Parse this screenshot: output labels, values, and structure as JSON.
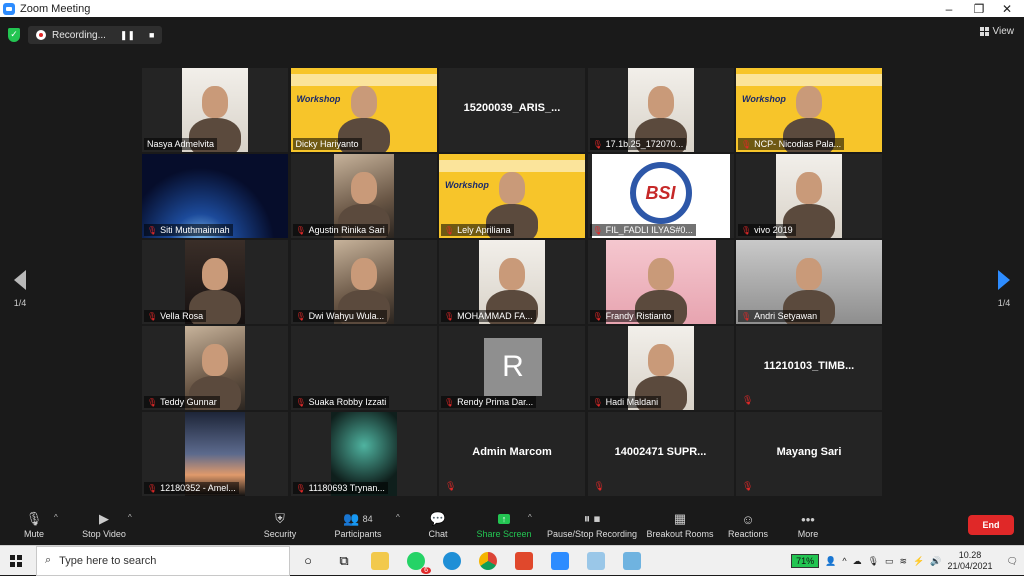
{
  "window": {
    "title": "Zoom Meeting",
    "minimize": "–",
    "maximize": "❐",
    "close": "✕"
  },
  "meeting": {
    "recording_label": "Recording...",
    "view_label": "View",
    "page_left": "1/4",
    "page_right": "1/4"
  },
  "participants": [
    {
      "name": "Nasya Admelvita",
      "muted": false,
      "type": "video",
      "scene": "light"
    },
    {
      "name": "Dicky Hariyanto",
      "muted": false,
      "type": "video",
      "scene": "poster",
      "active": true
    },
    {
      "name": "15200039_ARIS_...",
      "muted": false,
      "type": "noname"
    },
    {
      "name": "17.1b.25_172070...",
      "muted": true,
      "type": "video",
      "scene": "light"
    },
    {
      "name": "NCP- Nicodias Pala...",
      "muted": true,
      "type": "video",
      "scene": "poster"
    },
    {
      "name": "Siti Muthmainnah",
      "muted": true,
      "type": "video",
      "scene": "space"
    },
    {
      "name": "Agustin Rinika Sari",
      "muted": true,
      "type": "video",
      "scene": "room"
    },
    {
      "name": "Lely Apriliana",
      "muted": true,
      "type": "video",
      "scene": "poster"
    },
    {
      "name": "FIL_FADLI ILYAS#0...",
      "muted": true,
      "type": "video",
      "scene": "logo"
    },
    {
      "name": "vivo 2019",
      "muted": true,
      "type": "video",
      "scene": "light"
    },
    {
      "name": "Vella Rosa",
      "muted": true,
      "type": "video",
      "scene": "dark"
    },
    {
      "name": "Dwi Wahyu Wula...",
      "muted": true,
      "type": "video",
      "scene": "room"
    },
    {
      "name": "MOHAMMAD FA...",
      "muted": true,
      "type": "video",
      "scene": "light"
    },
    {
      "name": "Frandy Ristianto",
      "muted": true,
      "type": "video",
      "scene": "pink"
    },
    {
      "name": "Andri Setyawan",
      "muted": true,
      "type": "video",
      "scene": "grey"
    },
    {
      "name": "Teddy Gunnar",
      "muted": true,
      "type": "video",
      "scene": "room"
    },
    {
      "name": "Suaka Robby Izzati",
      "muted": true,
      "type": "blank"
    },
    {
      "name": "Rendy Prima Dar...",
      "muted": true,
      "type": "avatar",
      "initial": "R"
    },
    {
      "name": "Hadi Maldani",
      "muted": true,
      "type": "video",
      "scene": "light"
    },
    {
      "name": "11210103_TIMB...",
      "muted": true,
      "type": "noname"
    },
    {
      "name": "12180352 - Amel...",
      "muted": true,
      "type": "video",
      "scene": "sunset"
    },
    {
      "name": "11180693 Trynan...",
      "muted": true,
      "type": "video",
      "scene": "art"
    },
    {
      "name": "Admin Marcom",
      "muted": true,
      "type": "noname"
    },
    {
      "name": "14002471 SUPR...",
      "muted": true,
      "type": "noname"
    },
    {
      "name": "Mayang Sari",
      "muted": true,
      "type": "noname"
    }
  ],
  "poster_text": "Workshop",
  "logo_text": "BSI",
  "toolbar": {
    "mute": "Mute",
    "stop_video": "Stop Video",
    "security": "Security",
    "participants": "Participants",
    "participants_count": "84",
    "chat": "Chat",
    "share_screen": "Share Screen",
    "pause_stop_recording": "Pause/Stop Recording",
    "breakout_rooms": "Breakout Rooms",
    "reactions": "Reactions",
    "more": "More",
    "end": "End"
  },
  "taskbar": {
    "search_placeholder": "Type here to search",
    "battery": "71%",
    "time": "10.28",
    "date": "21/04/2021",
    "badge": "6"
  },
  "colors": {
    "accent": "#2d8cff",
    "end": "#e02828",
    "active_speaker": "#f5e04c",
    "share": "#23c552"
  }
}
